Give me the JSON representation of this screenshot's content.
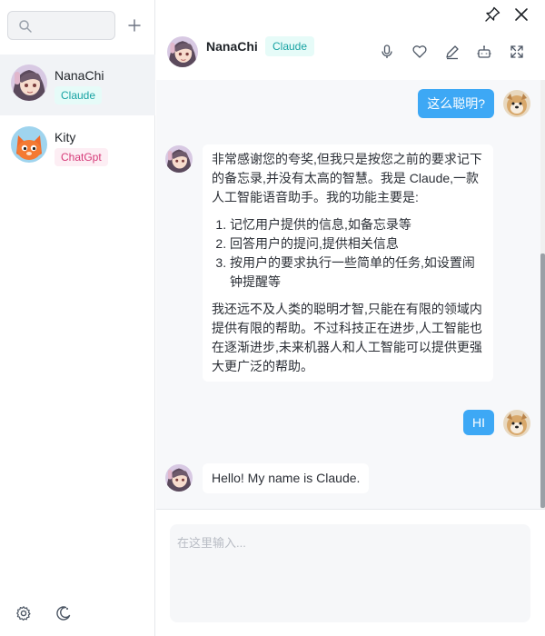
{
  "sidebar": {
    "search": {
      "placeholder": ""
    },
    "contacts": [
      {
        "name": "NanaChi",
        "tag": "Claude"
      },
      {
        "name": "Kity",
        "tag": "ChatGpt"
      }
    ]
  },
  "header": {
    "name": "NanaChi",
    "tag": "Claude"
  },
  "messages": [
    {
      "role": "user",
      "text": "这么聪明?"
    },
    {
      "role": "assistant",
      "intro": "非常感谢您的夸奖,但我只是按您之前的要求记下的备忘录,并没有太高的智慧。我是 Claude,一款人工智能语音助手。我的功能主要是:",
      "list": [
        "记忆用户提供的信息,如备忘录等",
        "回答用户的提问,提供相关信息",
        "按用户的要求执行一些简单的任务,如设置闹钟提醒等"
      ],
      "outro": "我还远不及人类的聪明才智,只能在有限的领域内提供有限的帮助。不过科技正在进步,人工智能也在逐渐进步,未来机器人和人工智能可以提供更强大更广泛的帮助。"
    },
    {
      "role": "user",
      "text": "HI"
    },
    {
      "role": "assistant",
      "text": "Hello! My name is Claude."
    }
  ],
  "input": {
    "placeholder": "在这里输入..."
  },
  "colors": {
    "accent": "#3da8f5",
    "claude_tag_bg": "#e6fbf8",
    "claude_tag_fg": "#18a3a3",
    "gpt_tag_bg": "#fdeef4",
    "gpt_tag_fg": "#d63a78"
  },
  "icons": {
    "topbar": [
      "pin-icon",
      "close-icon"
    ],
    "header": [
      "microphone-icon",
      "heart-icon",
      "edit-icon",
      "robot-icon",
      "fullscreen-icon"
    ],
    "sidebar_bottom": [
      "settings-icon",
      "theme-icon"
    ]
  }
}
